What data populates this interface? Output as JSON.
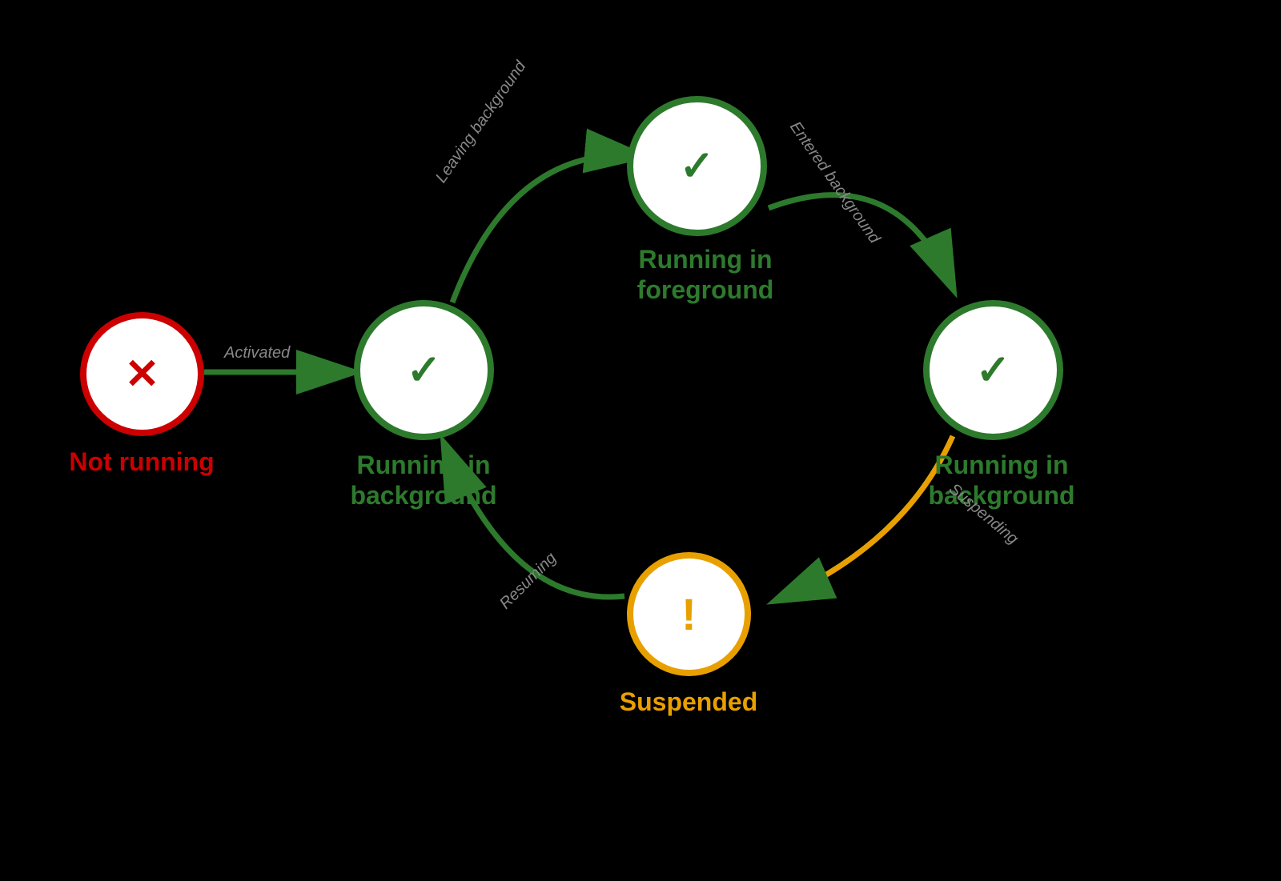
{
  "states": {
    "not_running": {
      "label": "Not running",
      "icon_type": "x",
      "icon_char": "✕",
      "color": "red"
    },
    "running_background_left": {
      "label": "Running in\nbackground",
      "icon_type": "check",
      "icon_char": "✓",
      "color": "green"
    },
    "running_foreground": {
      "label": "Running in\nforeground",
      "icon_type": "check",
      "icon_char": "✓",
      "color": "green"
    },
    "running_background_right": {
      "label": "Running in\nbackground",
      "icon_type": "check",
      "icon_char": "✓",
      "color": "green"
    },
    "suspended": {
      "label": "Suspended",
      "icon_type": "exclaim",
      "icon_char": "!",
      "color": "orange"
    }
  },
  "transitions": {
    "activated": "Activated",
    "leaving_background": "Leaving background",
    "entered_background": "Entered background",
    "suspending": "Suspending",
    "resuming": "Resuming"
  },
  "colors": {
    "green_arrow": "#2d7a2d",
    "orange_arrow": "#e8a000",
    "label_gray": "#888888",
    "background": "#000000"
  }
}
